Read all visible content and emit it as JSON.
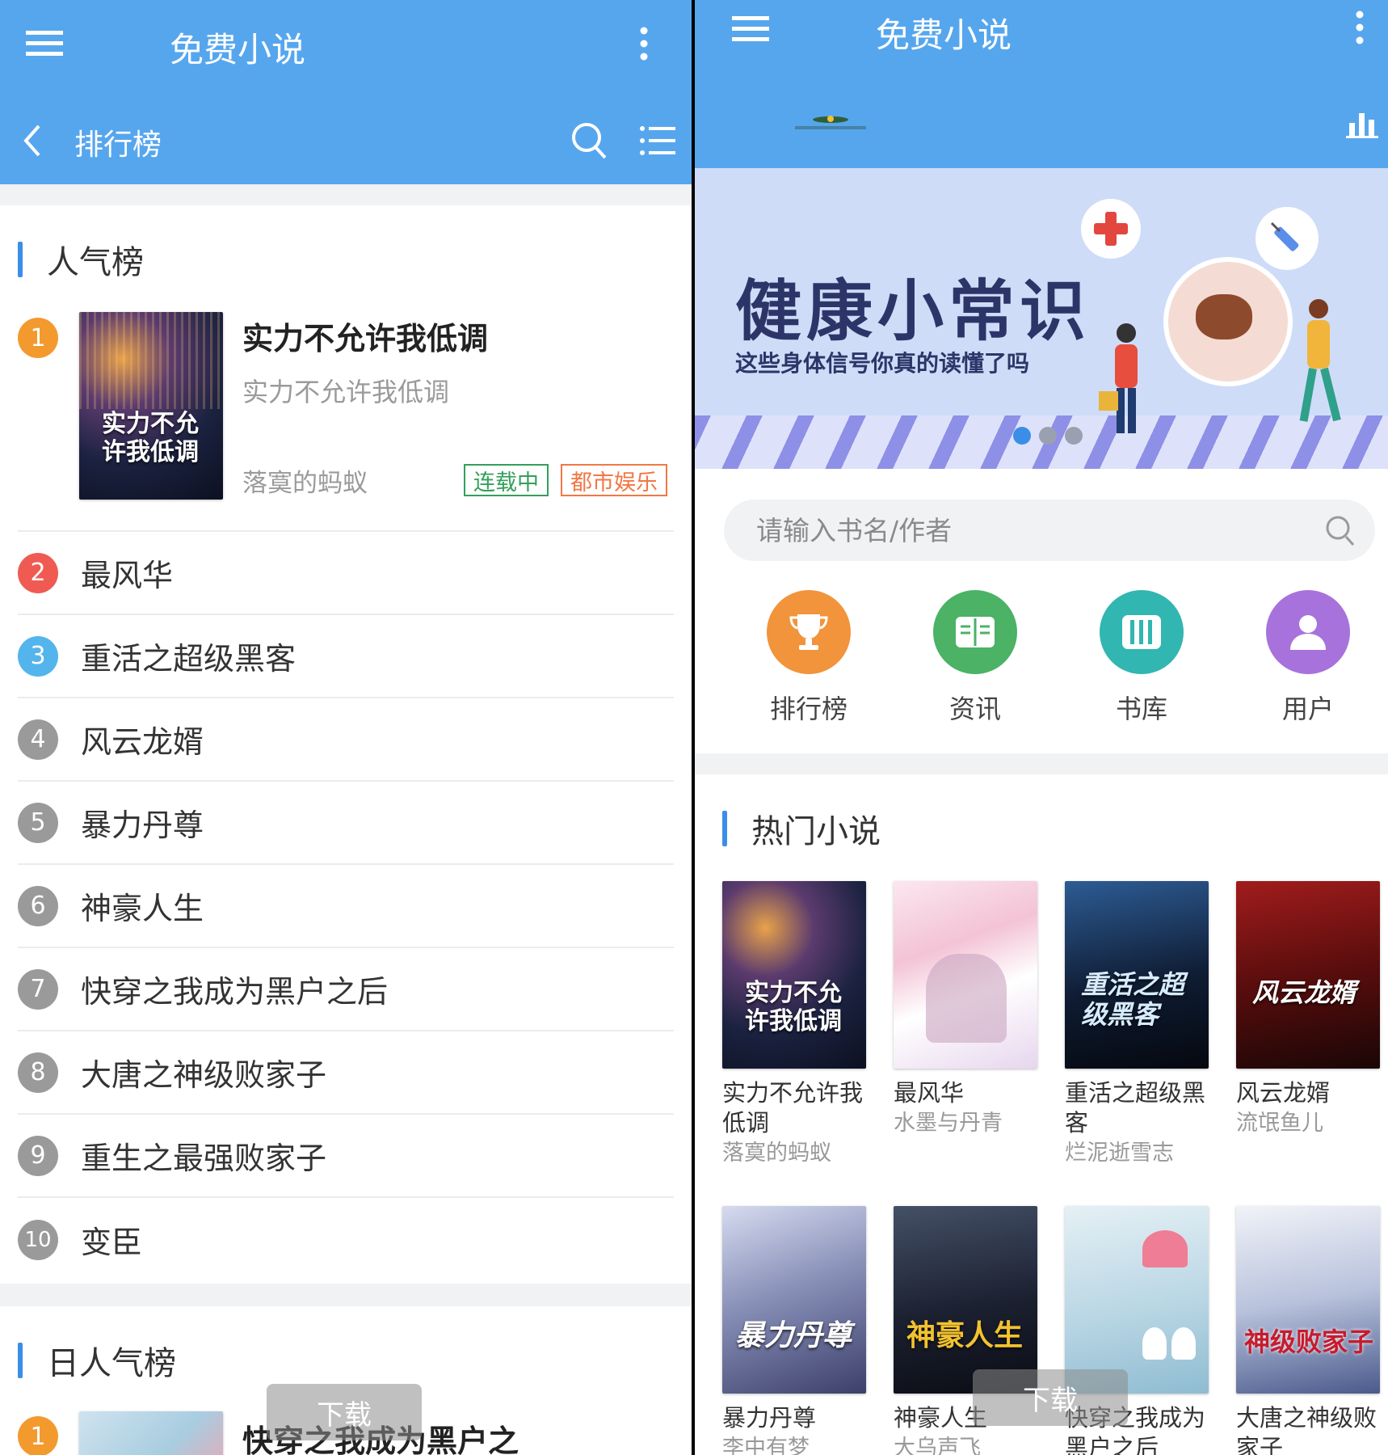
{
  "left": {
    "app_title": "免费小说",
    "sub_title": "排行榜",
    "sections": {
      "popular": "人气榜",
      "daily": "日人气榜"
    },
    "top_book": {
      "rank": "1",
      "title": "实力不允许我低调",
      "subtitle": "实力不允许我低调",
      "author": "落寞的蚂蚁",
      "status_tag": "连载中",
      "genre_tag": "都市娱乐",
      "cover_text": "实力不允许我低调"
    },
    "rank_list": [
      {
        "rank": "2",
        "title": "最风华"
      },
      {
        "rank": "3",
        "title": "重活之超级黑客"
      },
      {
        "rank": "4",
        "title": "风云龙婿"
      },
      {
        "rank": "5",
        "title": "暴力丹尊"
      },
      {
        "rank": "6",
        "title": "神豪人生"
      },
      {
        "rank": "7",
        "title": "快穿之我成为黑户之后"
      },
      {
        "rank": "8",
        "title": "大唐之神级败家子"
      },
      {
        "rank": "9",
        "title": "重生之最强败家子"
      },
      {
        "rank": "10",
        "title": "变臣"
      }
    ],
    "daily_top": {
      "rank": "1",
      "title": "快穿之我成为黑户之"
    },
    "toast": "下载"
  },
  "right": {
    "app_title": "免费小说",
    "banner": {
      "headline": "健康小常识",
      "subline": "这些身体信号你真的读懂了吗"
    },
    "search": {
      "placeholder": "请输入书名/作者"
    },
    "nav": [
      {
        "label": "排行榜",
        "icon": "trophy-icon",
        "color": "#f1943b"
      },
      {
        "label": "资讯",
        "icon": "book-open-icon",
        "color": "#4bb266"
      },
      {
        "label": "书库",
        "icon": "bookshelf-icon",
        "color": "#31b6b1"
      },
      {
        "label": "用户",
        "icon": "user-icon",
        "color": "#a772db"
      }
    ],
    "hot_title": "热门小说",
    "books_row1": [
      {
        "title": "实力不允许我低调",
        "author": "落寞的蚂蚁",
        "cover": "实力不允许我低调"
      },
      {
        "title": "最风华",
        "author": "水墨与丹青",
        "cover": ""
      },
      {
        "title": "重活之超级黑客",
        "author": "烂泥逝雪志",
        "cover": "重活之超级黑客"
      },
      {
        "title": "风云龙婿",
        "author": "流氓鱼儿",
        "cover": "风云龙婿"
      }
    ],
    "books_row2": [
      {
        "title": "暴力丹尊",
        "author": "李中有梦",
        "cover": "暴力丹尊"
      },
      {
        "title": "神豪人生",
        "author": "大乌声飞",
        "cover": "神豪人生"
      },
      {
        "title": "快穿之我成为黑户之后",
        "author": "",
        "cover": ""
      },
      {
        "title": "大唐之神级败家子",
        "author": "",
        "cover": "神级败家子"
      }
    ],
    "toast": "下载"
  },
  "colors": {
    "primary": "#56a6ee",
    "rank1": "#f39a2e",
    "rank2": "#ef5b52",
    "rank3": "#54b4ec",
    "rank_other": "#9a9a9a",
    "tag_green": "#33a05a",
    "tag_orange": "#f07845"
  }
}
